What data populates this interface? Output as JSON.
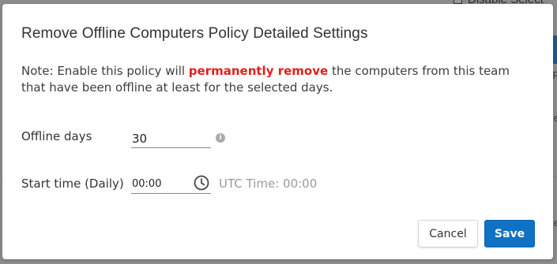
{
  "background": {
    "top_text": "Disable Select",
    "right_letters": [
      "P",
      "e",
      "e",
      "e"
    ]
  },
  "dialog": {
    "title": "Remove Offline Computers Policy Detailed Settings",
    "note": {
      "prefix": "Note: Enable this policy will ",
      "emphasis": "permanently remove",
      "suffix": " the computers from this team that have been offline at least for the selected days."
    },
    "offline_days": {
      "label": "Offline days",
      "value": "30",
      "info_icon": "info-icon"
    },
    "start_time": {
      "label": "Start time (Daily)",
      "value": "00:00",
      "clock_icon": "clock-icon",
      "utc_text": "UTC Time: 00:00"
    },
    "buttons": {
      "cancel": "Cancel",
      "save": "Save"
    }
  },
  "colors": {
    "danger": "#e0201b",
    "primary": "#0e72c5",
    "overlay": "#8c8c8c"
  }
}
